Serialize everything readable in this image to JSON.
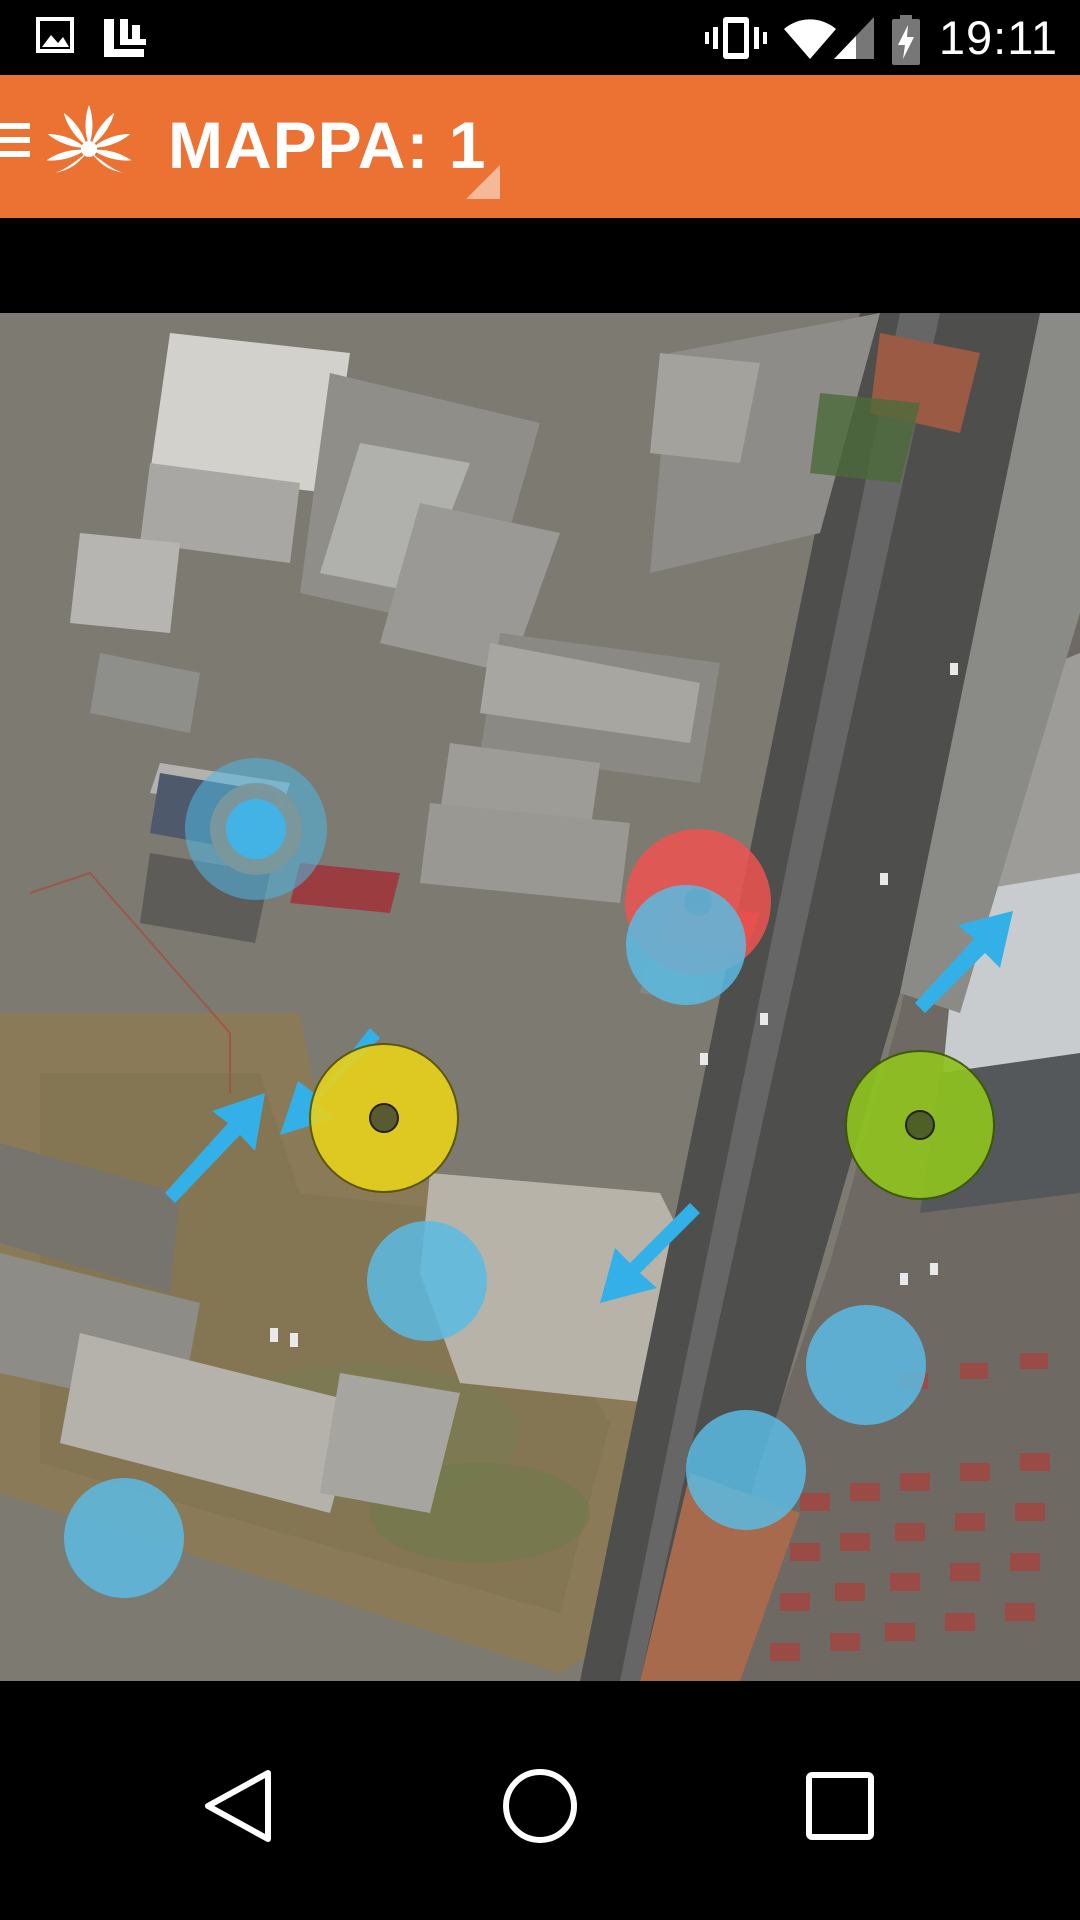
{
  "status_bar": {
    "time": "19:11",
    "icons": [
      "image-icon",
      "notification-icon",
      "vibrate-icon",
      "wifi-icon",
      "signal-icon",
      "battery-charging-icon"
    ]
  },
  "app_bar": {
    "title": "MAPPA: 1",
    "menu_icon": "hamburger-icon",
    "logo": "sun-logo-icon",
    "accent_color": "#ec7233"
  },
  "map": {
    "markers": [
      {
        "name": "target-marker-blue",
        "color": "#4fb8e6"
      },
      {
        "name": "marker-red",
        "color": "#ef5350"
      },
      {
        "name": "marker-blue-overlap",
        "color": "#5bbbe3"
      },
      {
        "name": "marker-yellow",
        "color": "#e8d21a"
      },
      {
        "name": "marker-green",
        "color": "#8fc31f"
      },
      {
        "name": "marker-blue-field",
        "color": "#5bbbe3"
      },
      {
        "name": "marker-blue-right",
        "color": "#5bbbe3"
      },
      {
        "name": "marker-blue-road",
        "color": "#5bbbe3"
      },
      {
        "name": "marker-blue-bottom-left",
        "color": "#5bbbe3"
      }
    ],
    "arrow_color": "#33b0e8"
  },
  "nav_bar": {
    "buttons": [
      "back-icon",
      "home-icon",
      "recents-icon"
    ]
  }
}
